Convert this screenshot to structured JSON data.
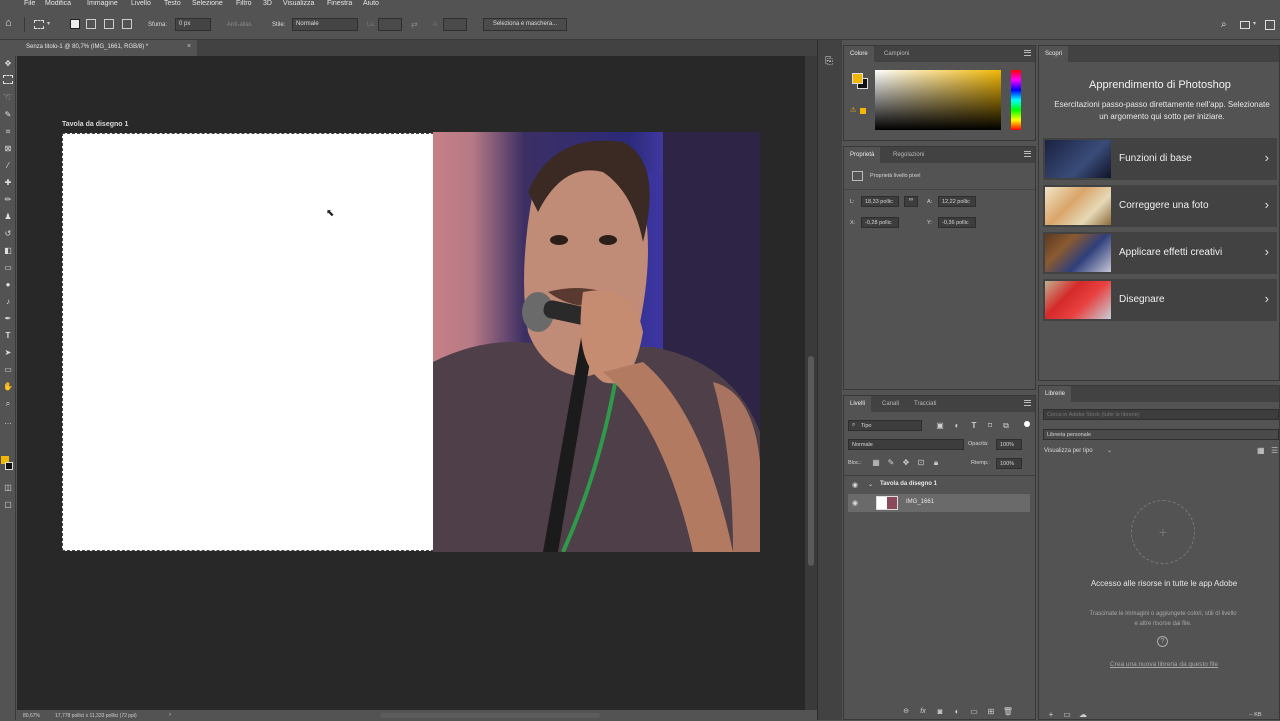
{
  "menu": [
    "File",
    "Modifica",
    "Immagine",
    "Livello",
    "Testo",
    "Selezione",
    "Filtro",
    "3D",
    "Visualizza",
    "Finestra",
    "Aiuto"
  ],
  "options": {
    "feather_label": "Sfuma:",
    "feather_value": "0 px",
    "antialias_label": "Anti-alias",
    "style_label": "Stile:",
    "style_value": "Normale",
    "width_label": "La:",
    "height_label": "A:",
    "select_mask_button": "Seleziona e maschera..."
  },
  "document": {
    "tab_title": "Senza titolo-1 @ 80,7% (IMG_1661, RGB/8) *",
    "artboard_label": "Tavola da disegno 1",
    "zoom": "80,67%",
    "doc_info": "17,778 pollici x 11,333 pollici (72 ppi)"
  },
  "colore_panel": {
    "tabs": [
      "Colore",
      "Campioni"
    ],
    "foreground_color": "#f2b705",
    "background_color": "#111111"
  },
  "properties_panel": {
    "tabs": [
      "Proprietà",
      "Regolazioni"
    ],
    "layer_type": "Proprietà livello pixel",
    "w_label": "L:",
    "w_value": "18,33 pollic",
    "h_label": "A:",
    "h_value": "12,22 pollic",
    "x_label": "X:",
    "x_value": "-0,28 pollic",
    "y_label": "Y:",
    "y_value": "-0,36 pollic"
  },
  "learn_panel": {
    "tab": "Scopri",
    "title": "Apprendimento di Photoshop",
    "subtitle": "Esercitazioni passo-passo direttamente nell'app. Selezionate un argomento qui sotto per iniziare.",
    "topics": [
      "Funzioni di base",
      "Correggere una foto",
      "Applicare effetti creativi",
      "Disegnare"
    ]
  },
  "layers_panel": {
    "tabs": [
      "Livelli",
      "Canali",
      "Tracciati"
    ],
    "filter_value": "Tipo",
    "blend_mode": "Normale",
    "opacity_label": "Opacità:",
    "opacity_value": "100%",
    "lock_label": "Bloc.:",
    "fill_label": "Riemp.:",
    "fill_value": "100%",
    "layers": [
      {
        "name": "Tavola da disegno 1"
      },
      {
        "name": "IMG_1661"
      }
    ]
  },
  "libraries_panel": {
    "tab": "Librerie",
    "search_placeholder": "Cerca in Adobe Stock (tutte le librerie)",
    "library_name": "Libreria personale",
    "view_label": "Visualizza per tipo",
    "headline": "Accesso alle risorse in tutte le app Adobe",
    "body": "Trascinate le immagini o aggiungete colori, stili di livello e altre risorse dai file.",
    "link": "Crea una nuova libreria da questo file",
    "size_indicator": "-- KB"
  }
}
